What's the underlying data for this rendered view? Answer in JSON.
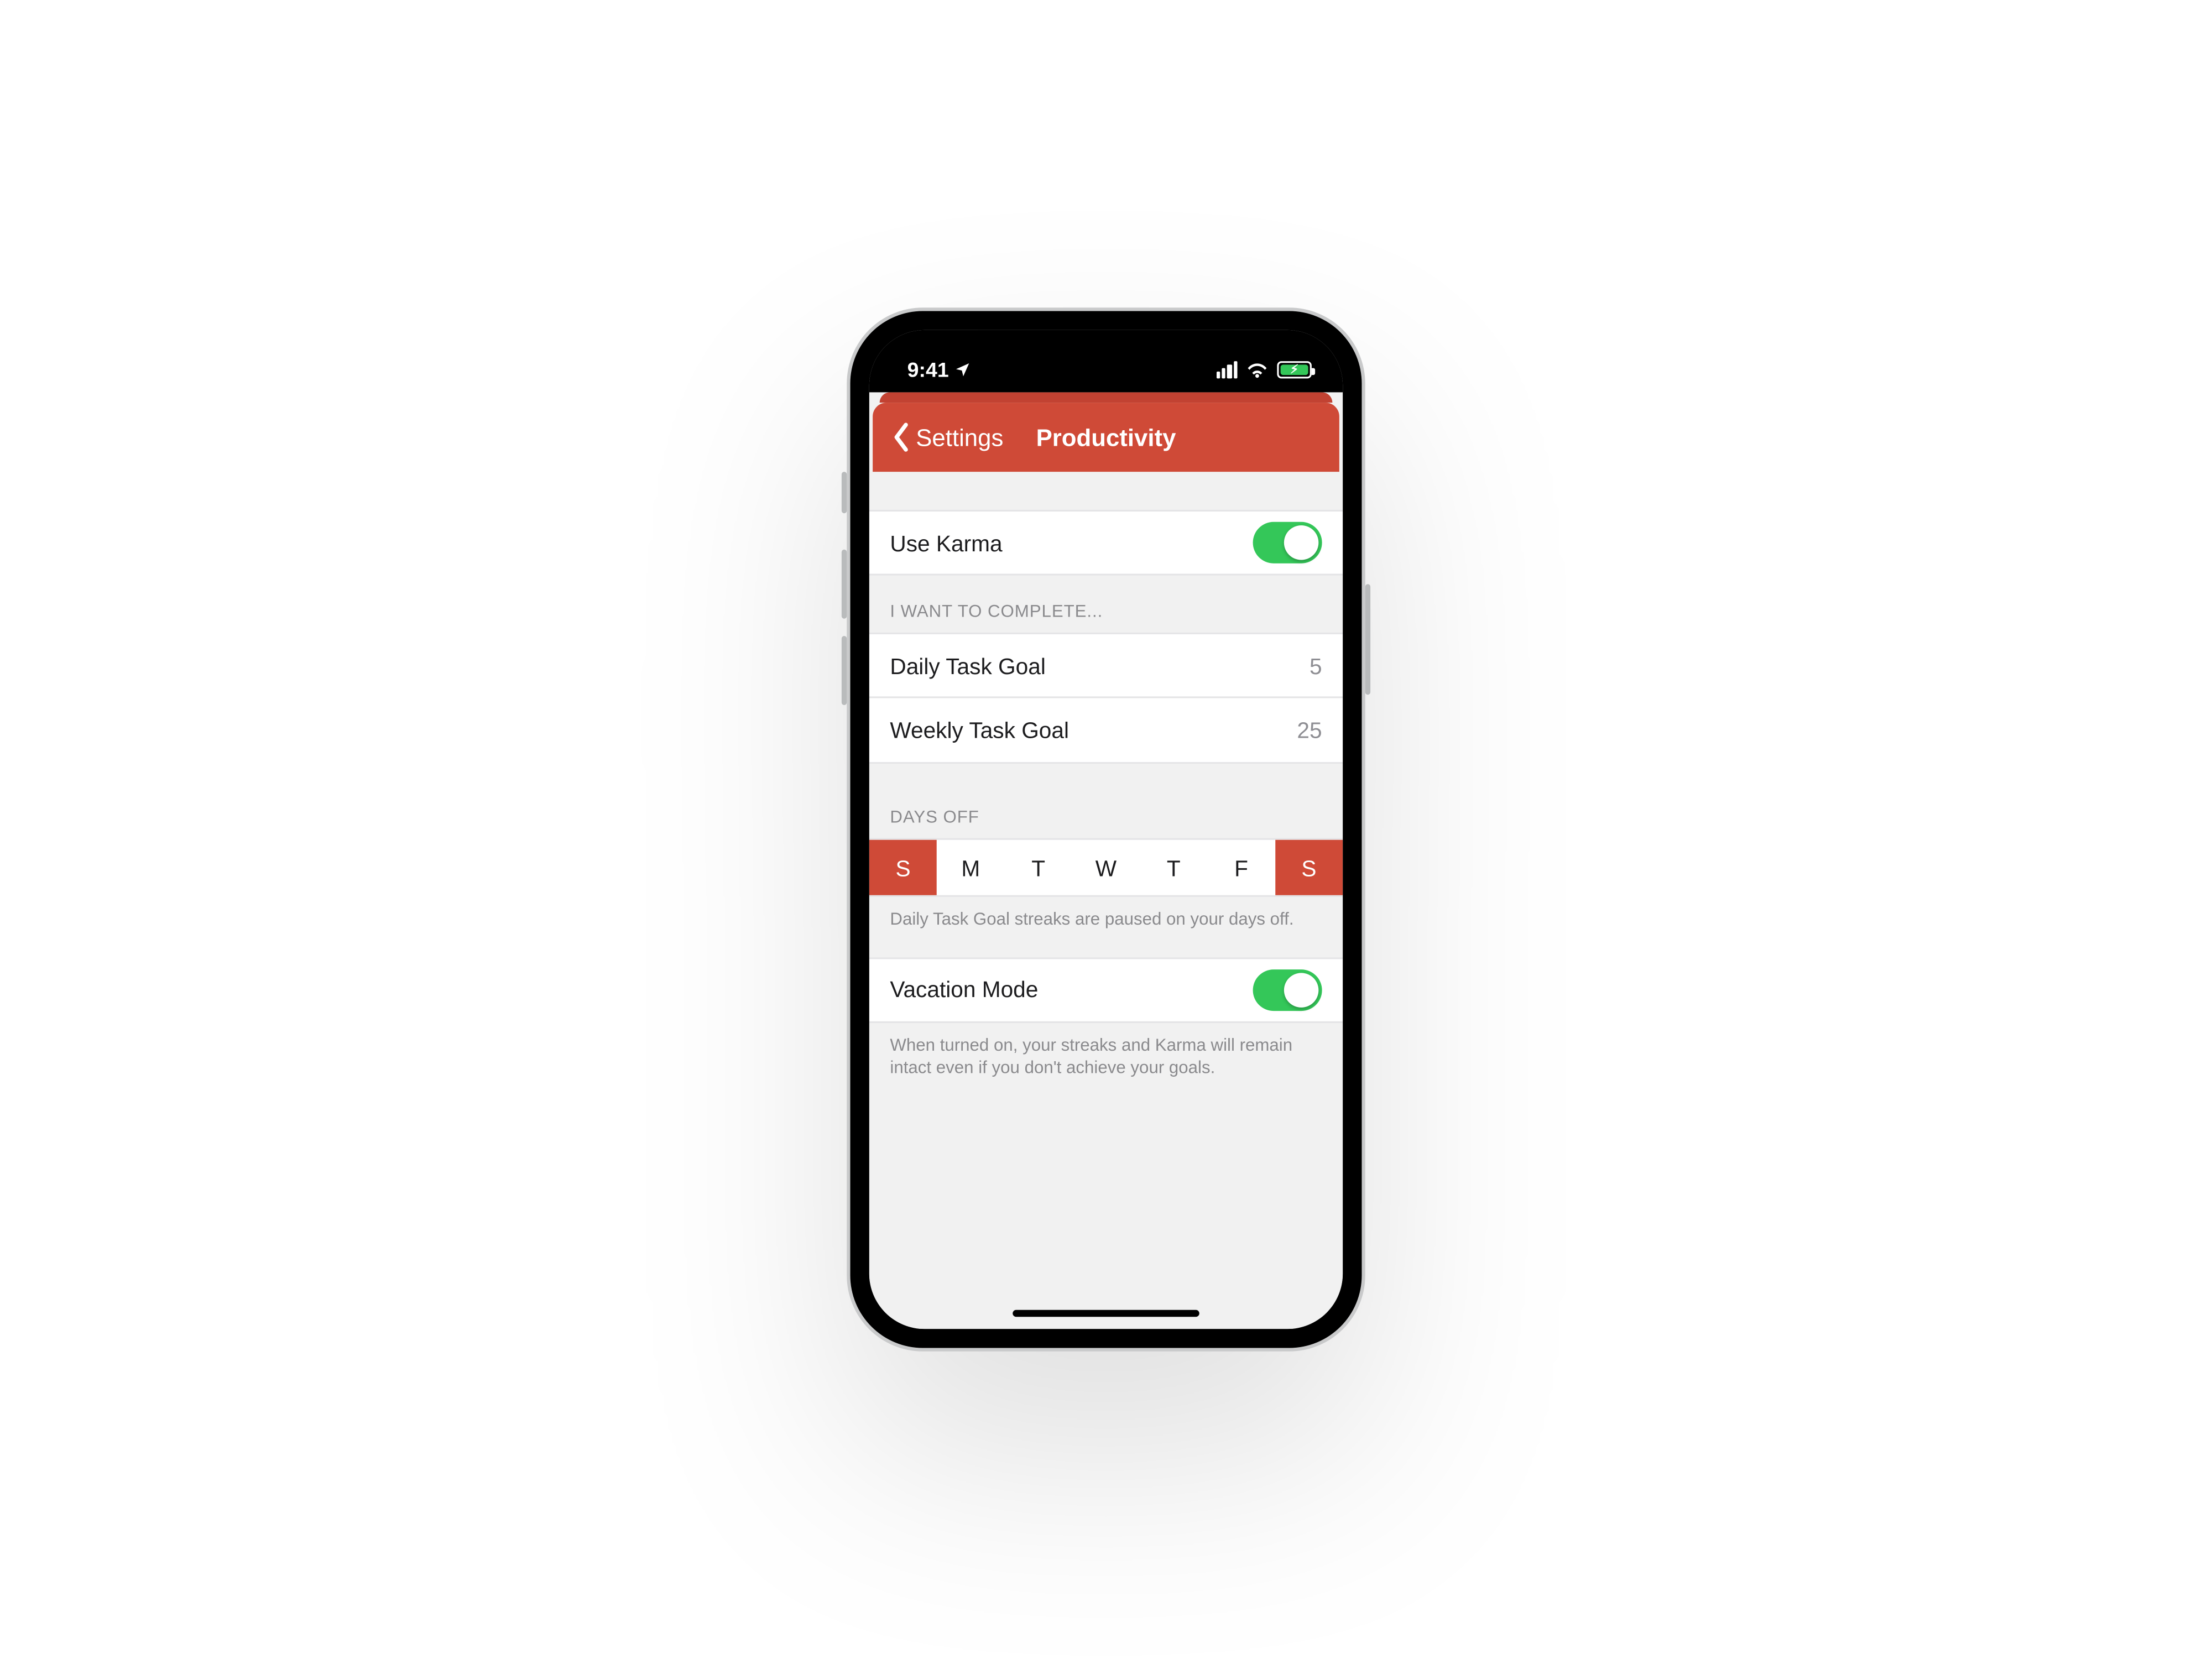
{
  "status": {
    "time": "9:41",
    "battery_charging": true
  },
  "navbar": {
    "back_label": "Settings",
    "title": "Productivity"
  },
  "karma": {
    "label": "Use Karma",
    "on": true
  },
  "goals": {
    "header": "I WANT TO COMPLETE...",
    "daily_label": "Daily Task Goal",
    "daily_value": "5",
    "weekly_label": "Weekly Task Goal",
    "weekly_value": "25"
  },
  "days_off": {
    "header": "DAYS OFF",
    "footer": "Daily Task Goal streaks are paused on your days off.",
    "days": [
      {
        "letter": "S",
        "selected": true
      },
      {
        "letter": "M",
        "selected": false
      },
      {
        "letter": "T",
        "selected": false
      },
      {
        "letter": "W",
        "selected": false
      },
      {
        "letter": "T",
        "selected": false
      },
      {
        "letter": "F",
        "selected": false
      },
      {
        "letter": "S",
        "selected": true
      }
    ]
  },
  "vacation": {
    "label": "Vacation Mode",
    "on": true,
    "footer": "When turned on, your streaks and Karma will remain intact even if you don't achieve your goals."
  },
  "colors": {
    "accent": "#cf4a37",
    "switch_on": "#34c759"
  }
}
